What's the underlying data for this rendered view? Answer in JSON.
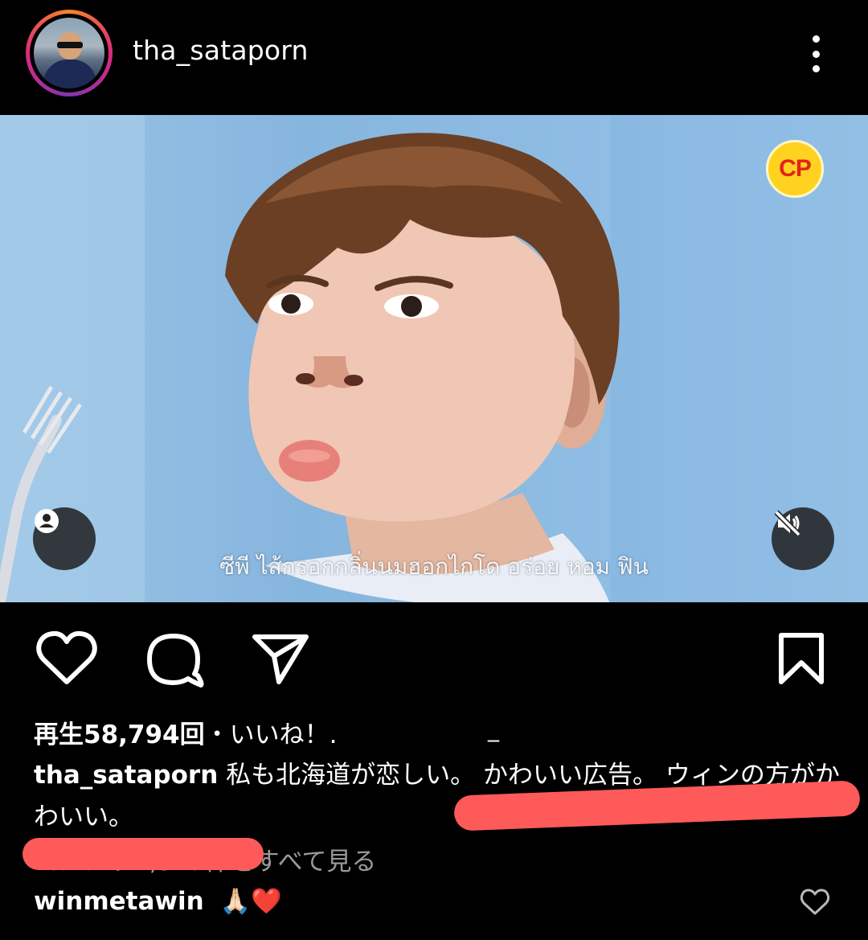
{
  "header": {
    "username": "tha_sataporn"
  },
  "video": {
    "brand_logo_text": "CP",
    "subtitle": "ซีพี ไส้กรอกกลิ่นนมฮอกไกโด อร่อย หอม ฟิน",
    "tag_icon": "person-tag-icon",
    "mute_icon": "speaker-muted-icon"
  },
  "actions": {
    "like_icon": "heart-outline-icon",
    "comment_icon": "comment-bubble-icon",
    "share_icon": "paper-plane-icon",
    "save_icon": "bookmark-outline-icon"
  },
  "stats": {
    "views_label": "再生58,794回",
    "likes_suffix": "・いいね！."
  },
  "caption": {
    "username": "tha_sataporn",
    "text": "私も北海道が恋しい。 かわいい広告。 ウィンの方がかわいい。"
  },
  "comments": {
    "view_all_label": "をすべて見る",
    "view_all_partial": "コメント1,317件",
    "first": {
      "username": "winmetawin",
      "text": "🙏🏻❤️"
    }
  },
  "colors": {
    "background": "#000000",
    "redaction": "#ff5a5a",
    "muted_text": "#9a9a9a",
    "brand_yellow": "#ffd21f",
    "brand_red": "#e2231a"
  }
}
